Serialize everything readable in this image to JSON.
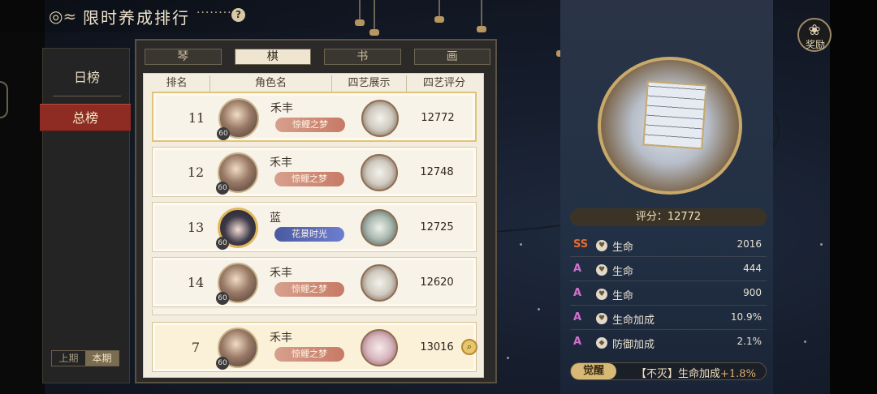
{
  "header": {
    "title": "限时养成排行",
    "dots": "········",
    "help_icon": "help-icon"
  },
  "reward": {
    "label": "奖励",
    "icon": "reward-icon"
  },
  "side_tabs": {
    "daily": "日榜",
    "total": "总榜",
    "period_prev": "上期",
    "period_current": "本期"
  },
  "tabs": [
    "琴",
    "棋",
    "书",
    "画"
  ],
  "active_tab": "棋",
  "list_header": {
    "rank": "排名",
    "name": "角色名",
    "show": "四艺展示",
    "score": "四艺评分"
  },
  "rows": [
    {
      "rank": "11",
      "name": "禾丰",
      "level": "60",
      "badge": "惊鲤之梦",
      "score": "12772"
    },
    {
      "rank": "12",
      "name": "禾丰",
      "level": "60",
      "badge": "惊鲤之梦",
      "score": "12748"
    },
    {
      "rank": "13",
      "name": "蓝",
      "level": "60",
      "badge": "花景时光",
      "score": "12725"
    },
    {
      "rank": "14",
      "name": "禾丰",
      "level": "60",
      "badge": "惊鲤之梦",
      "score": "12620"
    }
  ],
  "my_row": {
    "rank": "7",
    "name": "禾丰",
    "level": "60",
    "badge": "惊鲤之梦",
    "score": "13016"
  },
  "detail": {
    "score_label": "评分：12772",
    "stats": [
      {
        "grade": "SS",
        "name": "生命",
        "value": "2016",
        "icon": "heart-icon"
      },
      {
        "grade": "A",
        "name": "生命",
        "value": "444",
        "icon": "heart-icon"
      },
      {
        "grade": "A",
        "name": "生命",
        "value": "900",
        "icon": "heart-icon"
      },
      {
        "grade": "A",
        "name": "生命加成",
        "value": "10.9%",
        "icon": "heart-icon"
      },
      {
        "grade": "A",
        "name": "防御加成",
        "value": "2.1%",
        "icon": "shield-icon"
      }
    ],
    "awaken_label": "觉醒",
    "awaken_text": "【不灭】生命加成",
    "awaken_bonus": "+1.8%"
  },
  "colors": {
    "accent_red": "#8e2b22",
    "grade_ss": "#e66a2e",
    "grade_a": "#d36fd1",
    "gold": "#d7b874"
  }
}
